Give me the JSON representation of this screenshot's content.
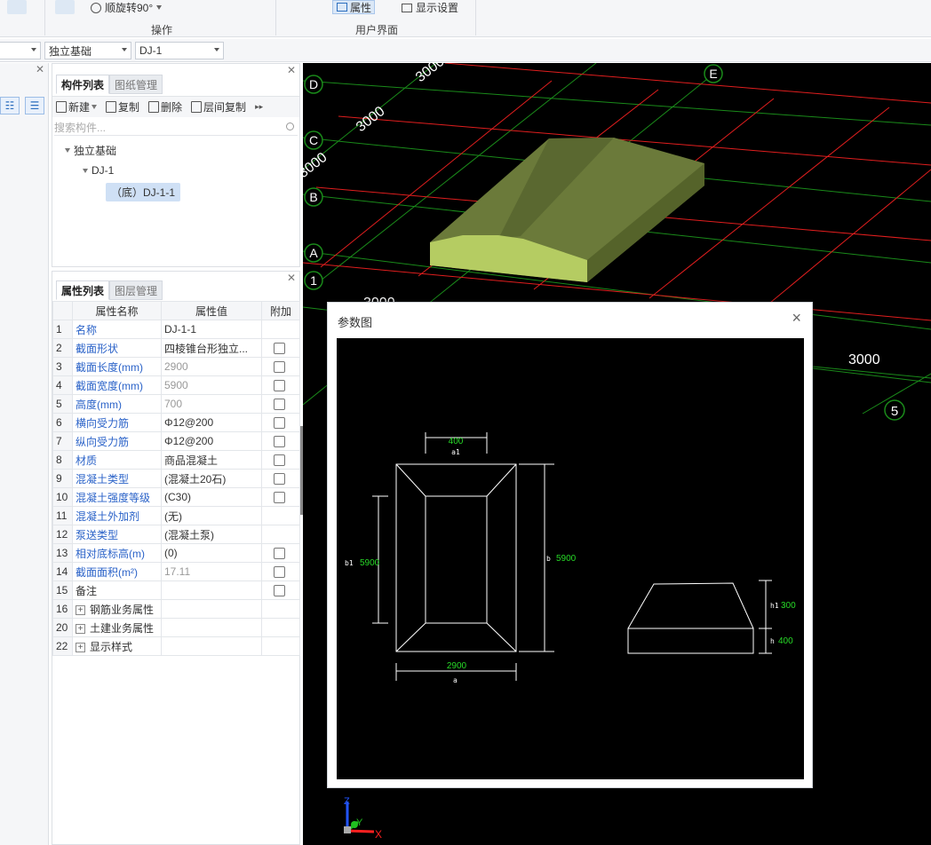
{
  "ribbon": {
    "rotate_label": "顺旋转90°",
    "group_operation": "操作",
    "property_label": "属性",
    "display_settings_label": "显示设置",
    "group_ui": "用户界面"
  },
  "selectors": {
    "type_value": "独立基础",
    "name_value": "DJ-1"
  },
  "component_panel": {
    "tabs": [
      "构件列表",
      "图纸管理"
    ],
    "toolbar": [
      "新建",
      "复制",
      "删除",
      "层间复制"
    ],
    "search_placeholder": "搜索构件...",
    "tree": {
      "root": "独立基础",
      "child": "DJ-1",
      "leaf": "（底）DJ-1-1"
    }
  },
  "property_panel": {
    "tabs": [
      "属性列表",
      "图层管理"
    ],
    "headers": [
      "属性名称",
      "属性值",
      "附加"
    ],
    "rows": [
      {
        "no": "1",
        "name": "名称",
        "value": "DJ-1-1",
        "blue": true,
        "gray": false,
        "check": false
      },
      {
        "no": "2",
        "name": "截面形状",
        "value": "四棱锥台形独立...",
        "blue": true,
        "gray": false,
        "check": true
      },
      {
        "no": "3",
        "name": "截面长度(mm)",
        "value": "2900",
        "blue": true,
        "gray": true,
        "check": true
      },
      {
        "no": "4",
        "name": "截面宽度(mm)",
        "value": "5900",
        "blue": true,
        "gray": true,
        "check": true
      },
      {
        "no": "5",
        "name": "高度(mm)",
        "value": "700",
        "blue": true,
        "gray": true,
        "check": true
      },
      {
        "no": "6",
        "name": "横向受力筋",
        "value": "Φ12@200",
        "blue": true,
        "gray": false,
        "check": true
      },
      {
        "no": "7",
        "name": "纵向受力筋",
        "value": "Φ12@200",
        "blue": true,
        "gray": false,
        "check": true
      },
      {
        "no": "8",
        "name": "材质",
        "value": "商品混凝土",
        "blue": true,
        "gray": false,
        "check": true
      },
      {
        "no": "9",
        "name": "混凝土类型",
        "value": "(混凝土20石)",
        "blue": true,
        "gray": false,
        "check": true
      },
      {
        "no": "10",
        "name": "混凝土强度等级",
        "value": "(C30)",
        "blue": true,
        "gray": false,
        "check": true
      },
      {
        "no": "11",
        "name": "混凝土外加剂",
        "value": "(无)",
        "blue": true,
        "gray": false,
        "check": false
      },
      {
        "no": "12",
        "name": "泵送类型",
        "value": "(混凝土泵)",
        "blue": true,
        "gray": false,
        "check": false
      },
      {
        "no": "13",
        "name": "相对底标高(m)",
        "value": "(0)",
        "blue": true,
        "gray": false,
        "check": true
      },
      {
        "no": "14",
        "name": "截面面积(m²)",
        "value": "17.11",
        "blue": true,
        "gray": true,
        "check": true
      },
      {
        "no": "15",
        "name": "备注",
        "value": "",
        "blue": false,
        "gray": false,
        "check": true
      }
    ],
    "groups": [
      {
        "no": "16",
        "name": "钢筋业务属性"
      },
      {
        "no": "20",
        "name": "土建业务属性"
      },
      {
        "no": "22",
        "name": "显示样式"
      }
    ]
  },
  "viewport": {
    "axis_letters": [
      "D",
      "C",
      "B",
      "A",
      "E"
    ],
    "axis_numbers": [
      "1",
      "5"
    ],
    "spacing_labels": [
      "3000",
      "3000",
      "3000",
      "3000",
      "3000"
    ],
    "axes_icon": {
      "x": "X",
      "y": "Y",
      "z": "Z"
    }
  },
  "dialog": {
    "title": "参数图",
    "close_label": "×",
    "labels": {
      "a1_value": "400",
      "a1_name": "a1",
      "b1_name": "b1",
      "b1_value": "5900",
      "b_name": "b",
      "b_value": "5900",
      "a_value": "2900",
      "a_name": "a",
      "h1_name": "h1",
      "h1_value": "300",
      "h_name": "h",
      "h_value": "400"
    }
  },
  "colors": {
    "grid_green": "#1a8a1a",
    "grid_red": "#e01e1e",
    "foundation_top": "#6b7a3a",
    "foundation_front": "#b5cc62",
    "dim_green": "#27d927",
    "label_blue": "#2a62c8"
  }
}
